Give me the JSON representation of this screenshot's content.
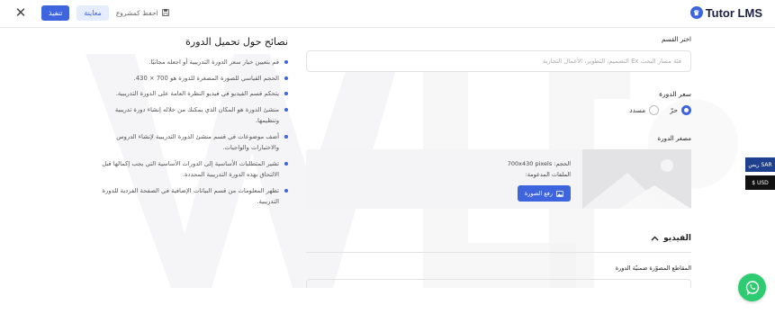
{
  "header": {
    "close_icon": "close-icon",
    "execute_label": "تنفيذ",
    "preview_label": "معاينة",
    "save_draft_label": "احفظ كمشروع",
    "save_icon": "save-icon",
    "logo_text": "Tutor LMS"
  },
  "tips": {
    "title": "نصائح حول تحميل الدورة",
    "items": [
      "قم بتعيين خيار سعر الدورة التدريبية أو اجعله مجانيًا.",
      "الحجم القياسي للصورة المصغرة للدورة هو 700 × 430.",
      "يتحكم قسم الفيديو في فيديو النظرة العامة على الدورة التدريبية.",
      "منشئ الدورة هو المكان الذي يمكنك من خلاله إنشاء دورة تدريبية وتنظيمها.",
      "أضف موضوعات في قسم منشئ الدورة التدريبية لإنشاء الدروس والاختبارات والواجبات.",
      "تشير المتطلبات الأساسية إلى الدورات الأساسية التي يجب إكمالها قبل الالتحاق بهذه الدورة التدريبية المحددة.",
      "تظهر المعلومات من قسم البيانات الإضافية في الصفحة الفردية للدورة التدريبية."
    ]
  },
  "form": {
    "category_label": "اختر القسم",
    "category_placeholder": "فئة مسار البحث Ex التصميم، التطوير، الأعمال التجارية",
    "price_label": "سعر الدورة",
    "price_options": [
      "حرّ",
      "مسدد"
    ],
    "thumbnail_label": "مصغر الدورة",
    "size_text": "الحجم: 700x430 pixels",
    "formats_text": "الملفات المدعومة:",
    "upload_label": "رفع الصورة",
    "video_section_label": "الفيديو",
    "clips_label": "المقاطع المصوّرة ضمنيّة الدورة"
  },
  "currency": {
    "sar_label": "ريس SAR",
    "usd_label": "$ USD"
  },
  "colors": {
    "accent": "#3e64de",
    "whatsapp": "#2ecc71"
  }
}
